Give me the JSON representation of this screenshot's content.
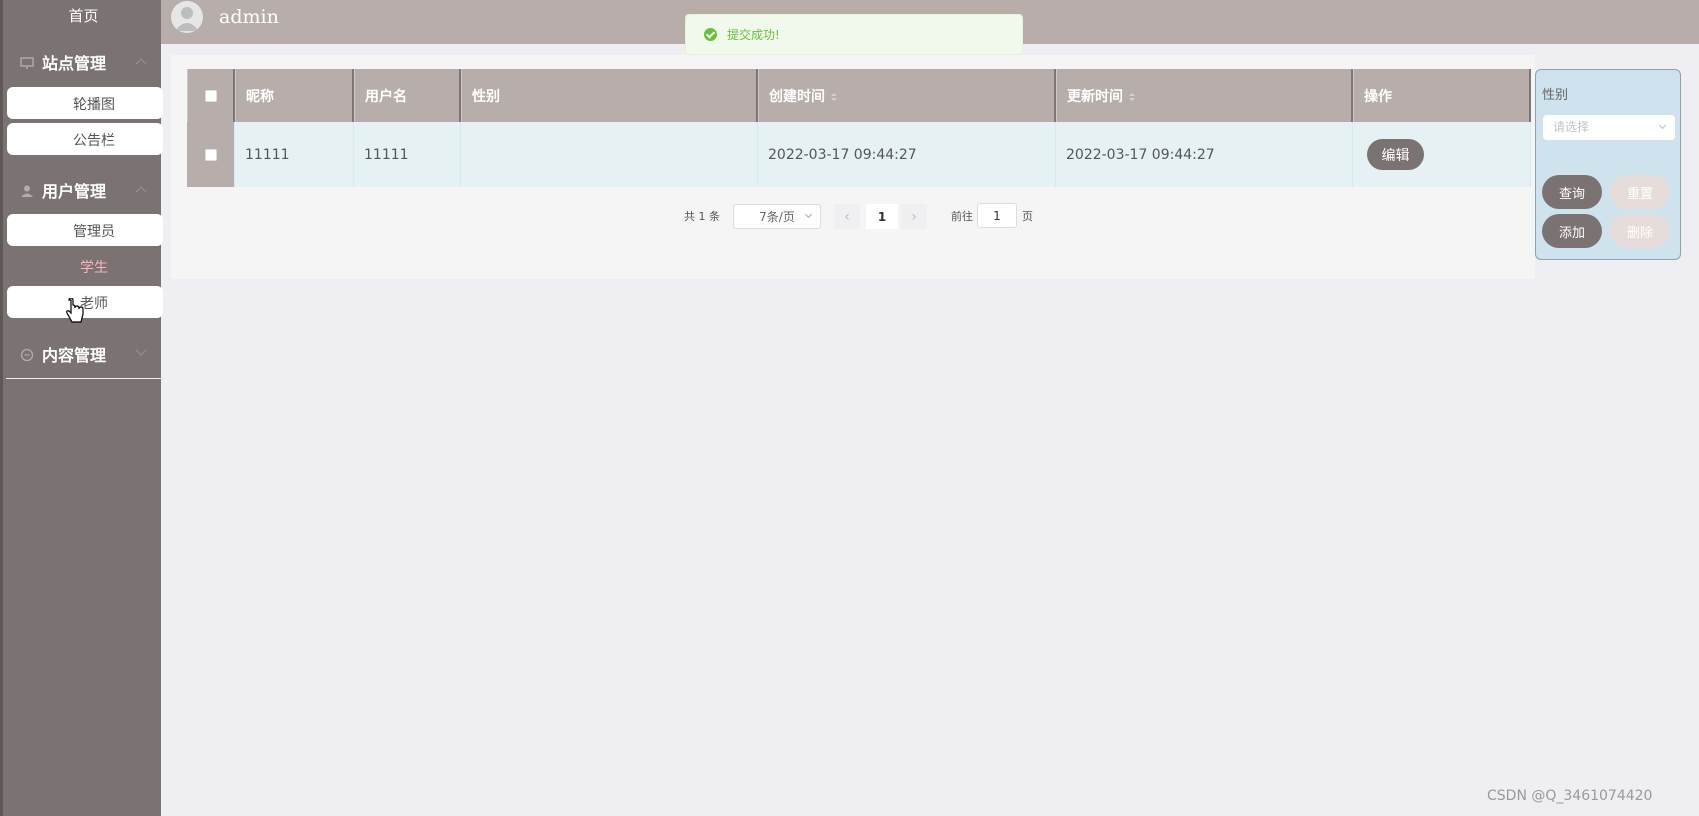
{
  "sidebar": {
    "home": "首页",
    "groups": [
      {
        "label": "站点管理",
        "items": [
          "轮播图",
          "公告栏"
        ]
      },
      {
        "label": "用户管理",
        "items": [
          "管理员",
          "学生",
          "老师"
        ]
      },
      {
        "label": "内容管理",
        "items": []
      }
    ],
    "active_item": "学生"
  },
  "header": {
    "username": "admin"
  },
  "toast": {
    "message": "提交成功!",
    "color": "#67c23a"
  },
  "table": {
    "columns": [
      "昵称",
      "用户名",
      "性别",
      "创建时间",
      "更新时间",
      "操作"
    ],
    "rows": [
      {
        "nickname": "11111",
        "username": "11111",
        "gender": "",
        "created": "2022-03-17 09:44:27",
        "updated": "2022-03-17 09:44:27",
        "action": "编辑"
      }
    ]
  },
  "pagination": {
    "total": "共 1 条",
    "page_size": "7条/页",
    "current": "1",
    "goto_label": "前往",
    "goto_value": "1",
    "unit": "页"
  },
  "filter": {
    "label": "性别",
    "placeholder": "请选择",
    "buttons": {
      "query": "查询",
      "reset": "重置",
      "add": "添加",
      "delete": "删除"
    }
  },
  "watermark": "CSDN @Q_3461074420",
  "colors": {
    "sidebar": "#7b7372",
    "header": "#b7aeab",
    "accent_pink": "#f9b2be",
    "filter_bg": "#cfe3ee"
  }
}
